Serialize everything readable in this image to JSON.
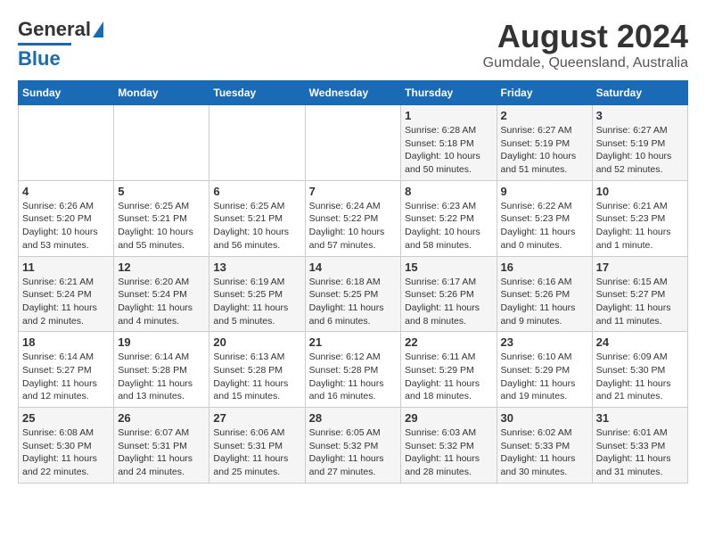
{
  "header": {
    "logo_general": "General",
    "logo_blue": "Blue",
    "title": "August 2024",
    "subtitle": "Gumdale, Queensland, Australia"
  },
  "days_of_week": [
    "Sunday",
    "Monday",
    "Tuesday",
    "Wednesday",
    "Thursday",
    "Friday",
    "Saturday"
  ],
  "weeks": [
    [
      {
        "day": "",
        "sunrise": "",
        "sunset": "",
        "daylight": ""
      },
      {
        "day": "",
        "sunrise": "",
        "sunset": "",
        "daylight": ""
      },
      {
        "day": "",
        "sunrise": "",
        "sunset": "",
        "daylight": ""
      },
      {
        "day": "",
        "sunrise": "",
        "sunset": "",
        "daylight": ""
      },
      {
        "day": "1",
        "sunrise": "Sunrise: 6:28 AM",
        "sunset": "Sunset: 5:18 PM",
        "daylight": "Daylight: 10 hours and 50 minutes."
      },
      {
        "day": "2",
        "sunrise": "Sunrise: 6:27 AM",
        "sunset": "Sunset: 5:19 PM",
        "daylight": "Daylight: 10 hours and 51 minutes."
      },
      {
        "day": "3",
        "sunrise": "Sunrise: 6:27 AM",
        "sunset": "Sunset: 5:19 PM",
        "daylight": "Daylight: 10 hours and 52 minutes."
      }
    ],
    [
      {
        "day": "4",
        "sunrise": "Sunrise: 6:26 AM",
        "sunset": "Sunset: 5:20 PM",
        "daylight": "Daylight: 10 hours and 53 minutes."
      },
      {
        "day": "5",
        "sunrise": "Sunrise: 6:25 AM",
        "sunset": "Sunset: 5:21 PM",
        "daylight": "Daylight: 10 hours and 55 minutes."
      },
      {
        "day": "6",
        "sunrise": "Sunrise: 6:25 AM",
        "sunset": "Sunset: 5:21 PM",
        "daylight": "Daylight: 10 hours and 56 minutes."
      },
      {
        "day": "7",
        "sunrise": "Sunrise: 6:24 AM",
        "sunset": "Sunset: 5:22 PM",
        "daylight": "Daylight: 10 hours and 57 minutes."
      },
      {
        "day": "8",
        "sunrise": "Sunrise: 6:23 AM",
        "sunset": "Sunset: 5:22 PM",
        "daylight": "Daylight: 10 hours and 58 minutes."
      },
      {
        "day": "9",
        "sunrise": "Sunrise: 6:22 AM",
        "sunset": "Sunset: 5:23 PM",
        "daylight": "Daylight: 11 hours and 0 minutes."
      },
      {
        "day": "10",
        "sunrise": "Sunrise: 6:21 AM",
        "sunset": "Sunset: 5:23 PM",
        "daylight": "Daylight: 11 hours and 1 minute."
      }
    ],
    [
      {
        "day": "11",
        "sunrise": "Sunrise: 6:21 AM",
        "sunset": "Sunset: 5:24 PM",
        "daylight": "Daylight: 11 hours and 2 minutes."
      },
      {
        "day": "12",
        "sunrise": "Sunrise: 6:20 AM",
        "sunset": "Sunset: 5:24 PM",
        "daylight": "Daylight: 11 hours and 4 minutes."
      },
      {
        "day": "13",
        "sunrise": "Sunrise: 6:19 AM",
        "sunset": "Sunset: 5:25 PM",
        "daylight": "Daylight: 11 hours and 5 minutes."
      },
      {
        "day": "14",
        "sunrise": "Sunrise: 6:18 AM",
        "sunset": "Sunset: 5:25 PM",
        "daylight": "Daylight: 11 hours and 6 minutes."
      },
      {
        "day": "15",
        "sunrise": "Sunrise: 6:17 AM",
        "sunset": "Sunset: 5:26 PM",
        "daylight": "Daylight: 11 hours and 8 minutes."
      },
      {
        "day": "16",
        "sunrise": "Sunrise: 6:16 AM",
        "sunset": "Sunset: 5:26 PM",
        "daylight": "Daylight: 11 hours and 9 minutes."
      },
      {
        "day": "17",
        "sunrise": "Sunrise: 6:15 AM",
        "sunset": "Sunset: 5:27 PM",
        "daylight": "Daylight: 11 hours and 11 minutes."
      }
    ],
    [
      {
        "day": "18",
        "sunrise": "Sunrise: 6:14 AM",
        "sunset": "Sunset: 5:27 PM",
        "daylight": "Daylight: 11 hours and 12 minutes."
      },
      {
        "day": "19",
        "sunrise": "Sunrise: 6:14 AM",
        "sunset": "Sunset: 5:28 PM",
        "daylight": "Daylight: 11 hours and 13 minutes."
      },
      {
        "day": "20",
        "sunrise": "Sunrise: 6:13 AM",
        "sunset": "Sunset: 5:28 PM",
        "daylight": "Daylight: 11 hours and 15 minutes."
      },
      {
        "day": "21",
        "sunrise": "Sunrise: 6:12 AM",
        "sunset": "Sunset: 5:28 PM",
        "daylight": "Daylight: 11 hours and 16 minutes."
      },
      {
        "day": "22",
        "sunrise": "Sunrise: 6:11 AM",
        "sunset": "Sunset: 5:29 PM",
        "daylight": "Daylight: 11 hours and 18 minutes."
      },
      {
        "day": "23",
        "sunrise": "Sunrise: 6:10 AM",
        "sunset": "Sunset: 5:29 PM",
        "daylight": "Daylight: 11 hours and 19 minutes."
      },
      {
        "day": "24",
        "sunrise": "Sunrise: 6:09 AM",
        "sunset": "Sunset: 5:30 PM",
        "daylight": "Daylight: 11 hours and 21 minutes."
      }
    ],
    [
      {
        "day": "25",
        "sunrise": "Sunrise: 6:08 AM",
        "sunset": "Sunset: 5:30 PM",
        "daylight": "Daylight: 11 hours and 22 minutes."
      },
      {
        "day": "26",
        "sunrise": "Sunrise: 6:07 AM",
        "sunset": "Sunset: 5:31 PM",
        "daylight": "Daylight: 11 hours and 24 minutes."
      },
      {
        "day": "27",
        "sunrise": "Sunrise: 6:06 AM",
        "sunset": "Sunset: 5:31 PM",
        "daylight": "Daylight: 11 hours and 25 minutes."
      },
      {
        "day": "28",
        "sunrise": "Sunrise: 6:05 AM",
        "sunset": "Sunset: 5:32 PM",
        "daylight": "Daylight: 11 hours and 27 minutes."
      },
      {
        "day": "29",
        "sunrise": "Sunrise: 6:03 AM",
        "sunset": "Sunset: 5:32 PM",
        "daylight": "Daylight: 11 hours and 28 minutes."
      },
      {
        "day": "30",
        "sunrise": "Sunrise: 6:02 AM",
        "sunset": "Sunset: 5:33 PM",
        "daylight": "Daylight: 11 hours and 30 minutes."
      },
      {
        "day": "31",
        "sunrise": "Sunrise: 6:01 AM",
        "sunset": "Sunset: 5:33 PM",
        "daylight": "Daylight: 11 hours and 31 minutes."
      }
    ]
  ]
}
